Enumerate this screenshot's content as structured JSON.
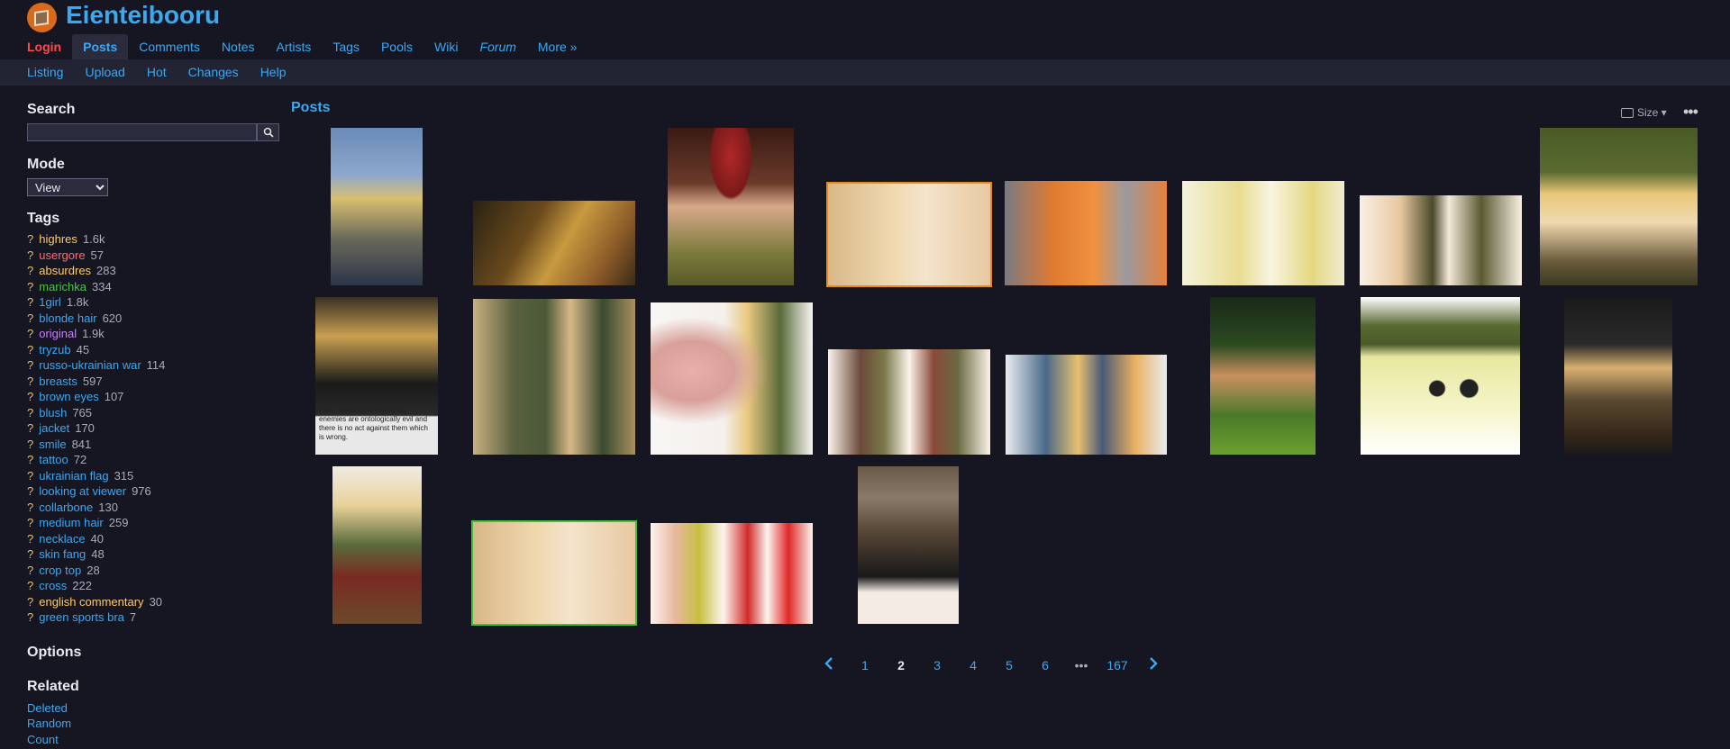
{
  "site": {
    "name": "Eienteibooru"
  },
  "main_nav": [
    {
      "label": "Login"
    },
    {
      "label": "Posts"
    },
    {
      "label": "Comments"
    },
    {
      "label": "Notes"
    },
    {
      "label": "Artists"
    },
    {
      "label": "Tags"
    },
    {
      "label": "Pools"
    },
    {
      "label": "Wiki"
    },
    {
      "label": "Forum"
    },
    {
      "label": "More »"
    }
  ],
  "sub_nav": [
    {
      "label": "Listing"
    },
    {
      "label": "Upload"
    },
    {
      "label": "Hot"
    },
    {
      "label": "Changes"
    },
    {
      "label": "Help"
    }
  ],
  "sidebar": {
    "search_heading": "Search",
    "search_value": "",
    "mode_heading": "Mode",
    "mode_value": "View",
    "tags_heading": "Tags",
    "tags": [
      {
        "q": "?",
        "name": "highres",
        "count": "1.6k"
      },
      {
        "q": "?",
        "name": "usergore",
        "count": "57"
      },
      {
        "q": "?",
        "name": "absurdres",
        "count": "283"
      },
      {
        "q": "?",
        "name": "marichka",
        "count": "334"
      },
      {
        "q": "?",
        "name": "1girl",
        "count": "1.8k"
      },
      {
        "q": "?",
        "name": "blonde hair",
        "count": "620"
      },
      {
        "q": "?",
        "name": "original",
        "count": "1.9k"
      },
      {
        "q": "?",
        "name": "tryzub",
        "count": "45"
      },
      {
        "q": "?",
        "name": "russo-ukrainian war",
        "count": "114"
      },
      {
        "q": "?",
        "name": "breasts",
        "count": "597"
      },
      {
        "q": "?",
        "name": "brown eyes",
        "count": "107"
      },
      {
        "q": "?",
        "name": "blush",
        "count": "765"
      },
      {
        "q": "?",
        "name": "jacket",
        "count": "170"
      },
      {
        "q": "?",
        "name": "smile",
        "count": "841"
      },
      {
        "q": "?",
        "name": "tattoo",
        "count": "72"
      },
      {
        "q": "?",
        "name": "ukrainian flag",
        "count": "315"
      },
      {
        "q": "?",
        "name": "looking at viewer",
        "count": "976"
      },
      {
        "q": "?",
        "name": "collarbone",
        "count": "130"
      },
      {
        "q": "?",
        "name": "medium hair",
        "count": "259"
      },
      {
        "q": "?",
        "name": "necklace",
        "count": "40"
      },
      {
        "q": "?",
        "name": "skin fang",
        "count": "48"
      },
      {
        "q": "?",
        "name": "crop top",
        "count": "28"
      },
      {
        "q": "?",
        "name": "cross",
        "count": "222"
      },
      {
        "q": "?",
        "name": "english commentary",
        "count": "30"
      },
      {
        "q": "?",
        "name": "green sports bra",
        "count": "7"
      }
    ],
    "options_heading": "Options",
    "related_heading": "Related",
    "related_links": [
      {
        "label": "Deleted"
      },
      {
        "label": "Random"
      },
      {
        "label": "Count"
      }
    ]
  },
  "posts": {
    "title": "Posts",
    "size_label": "Size ▾",
    "more_label": "•••",
    "thumb_text": "How I wake up knowing my enemies are ontologically evil and there is no act against them which is wrong."
  },
  "pager": {
    "pages": [
      "1",
      "2",
      "3",
      "4",
      "5",
      "6",
      "•••",
      "167"
    ],
    "current": "2"
  },
  "colors": {
    "background": "#151622",
    "link": "#3ba9f2",
    "login": "#ff4a4a",
    "subnav_bg": "#222333"
  }
}
